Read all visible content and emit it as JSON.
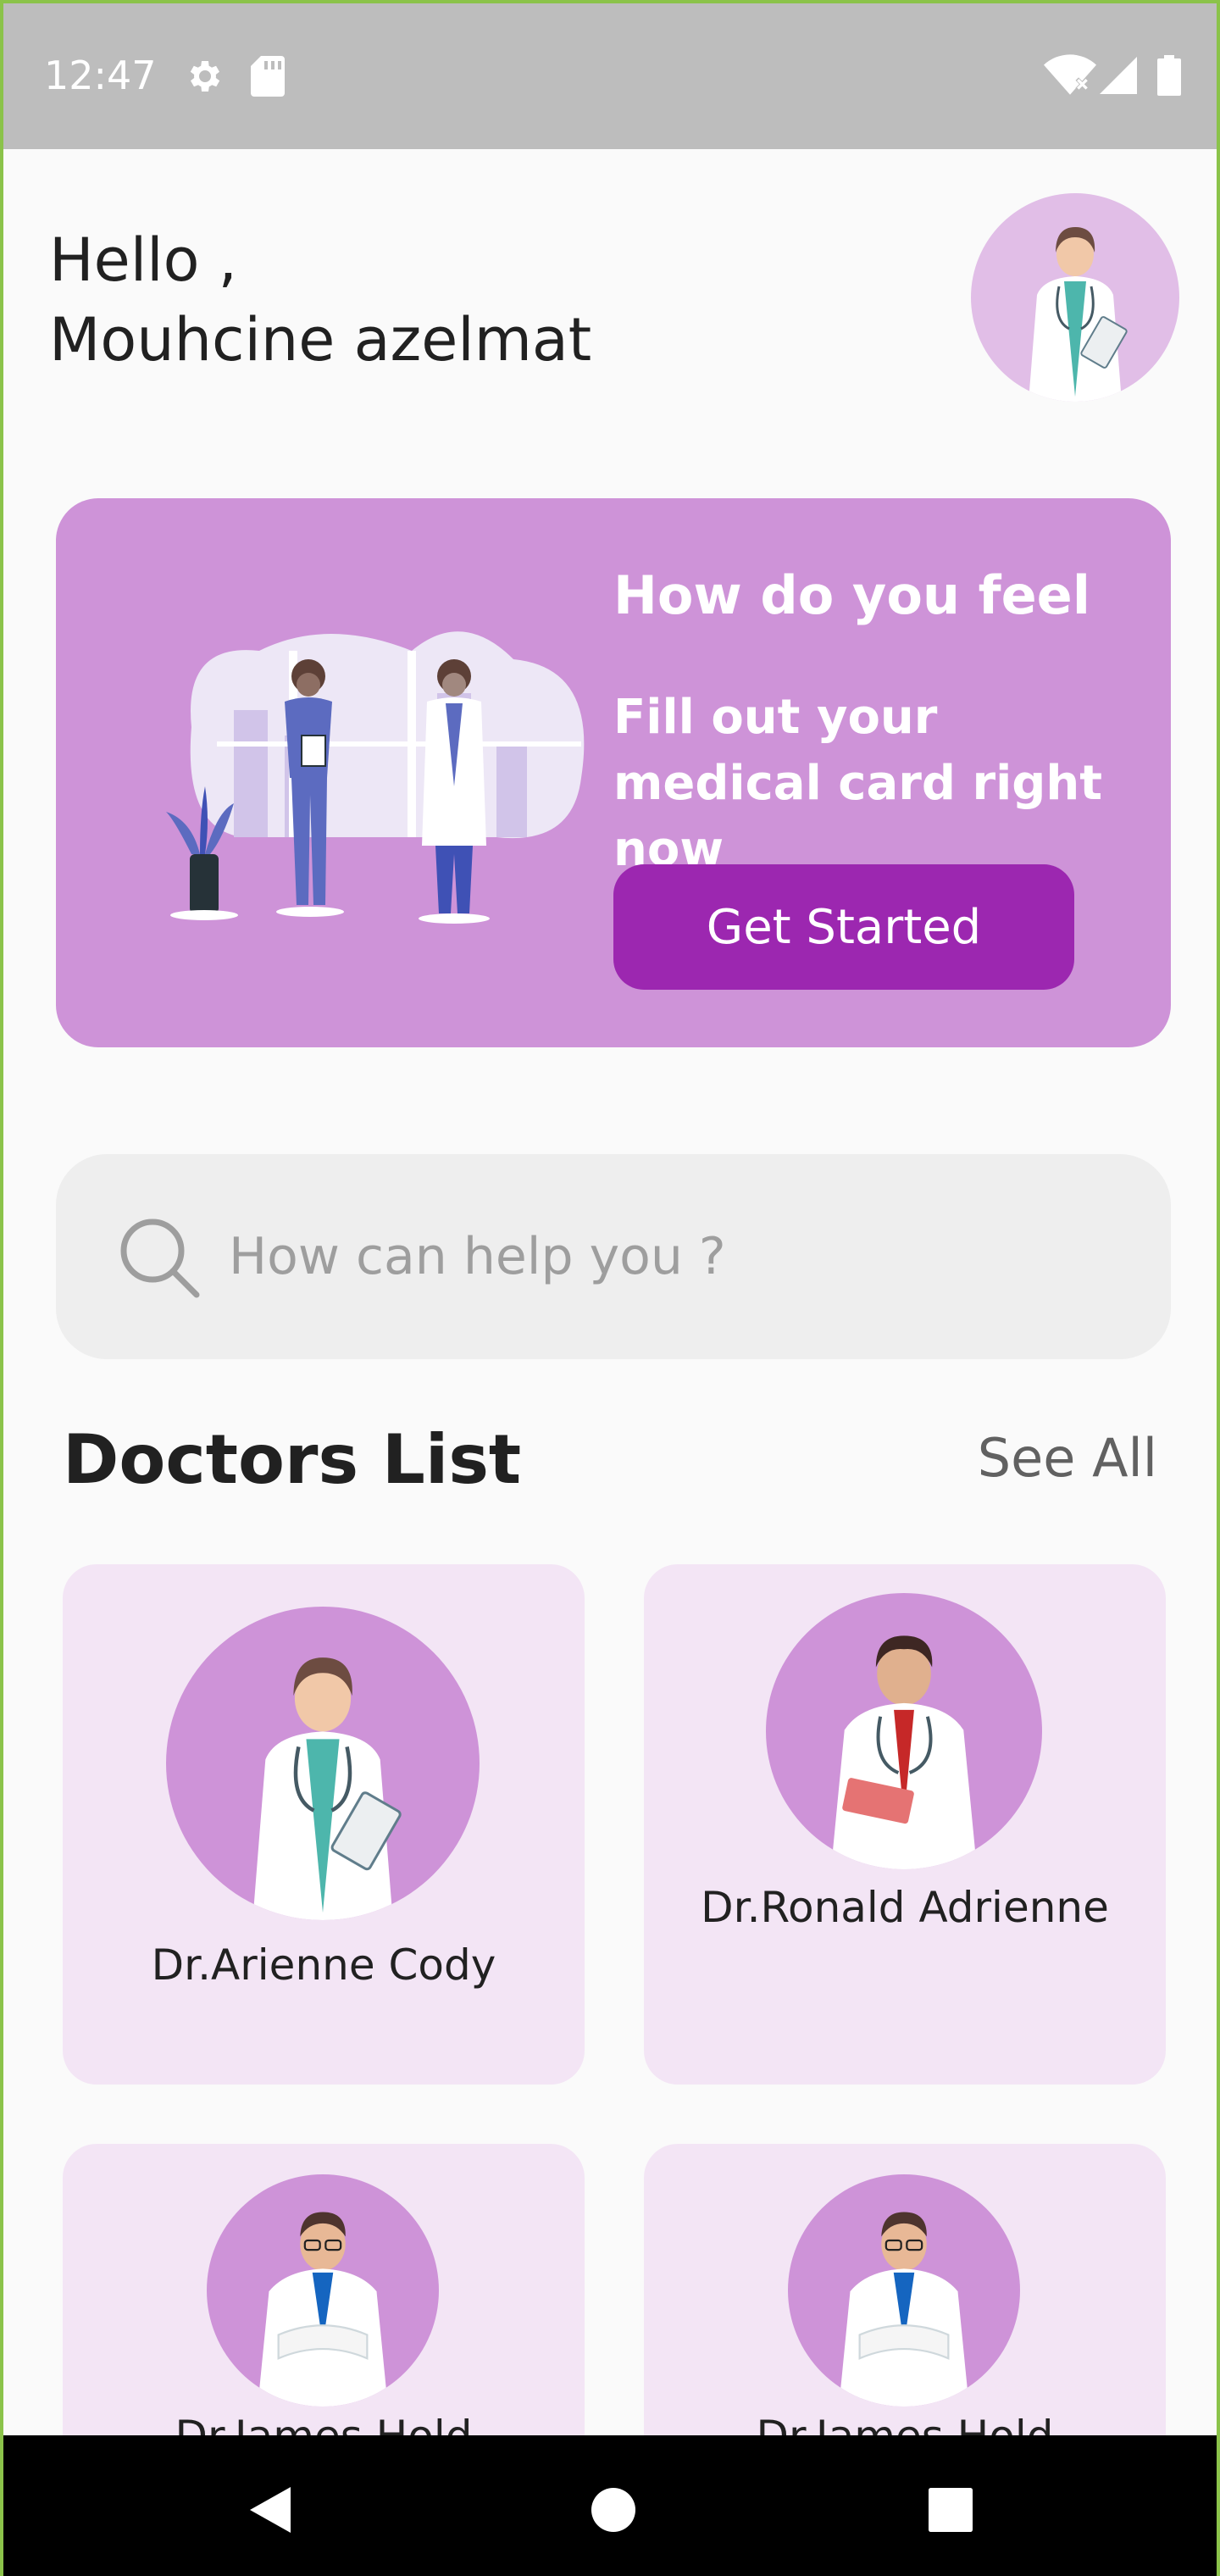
{
  "status_bar": {
    "time": "12:47",
    "icons": [
      "gear-icon",
      "sd-card-icon",
      "wifi-icon",
      "signal-icon",
      "battery-icon"
    ]
  },
  "header": {
    "greeting_line1": "Hello ,",
    "greeting_line2": "Mouhcine azelmat"
  },
  "banner": {
    "title": "How do you feel",
    "subtitle": "Fill out your medical card right now",
    "button_label": "Get Started"
  },
  "search": {
    "placeholder": "How can help you ?"
  },
  "doctors_section": {
    "title": "Doctors List",
    "see_all_label": "See All",
    "doctors": [
      {
        "name": "Dr.Arienne Cody"
      },
      {
        "name": "Dr.Ronald Adrienne"
      },
      {
        "name": "Dr.James Hold"
      },
      {
        "name": "Dr.James Hold"
      }
    ]
  },
  "nav": {
    "icons": [
      "back-icon",
      "home-icon",
      "recents-icon"
    ]
  },
  "colors": {
    "accent": "#9c27b0",
    "banner_bg": "#ce93d8",
    "card_bg": "#f3e5f5",
    "status_bar": "#bdbdbd"
  }
}
